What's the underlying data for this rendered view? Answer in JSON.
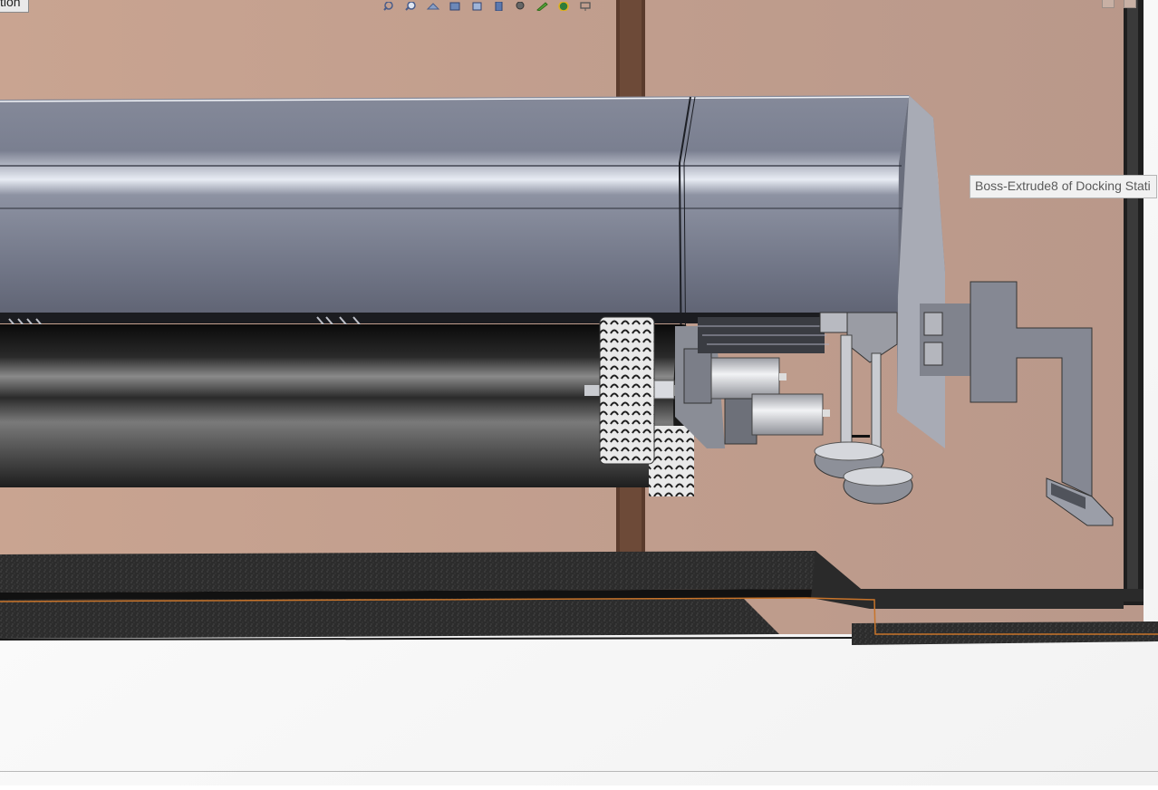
{
  "viewport": {
    "tab_label": "tion",
    "tooltip": "Boss-Extrude8 of Docking Stati",
    "background_color": "#c8a38f",
    "floor_color": "#ffffff",
    "accent_edge_color": "#c8742a"
  },
  "heads_up_toolbar": {
    "buttons": [
      "zoom-to-fit-icon",
      "zoom-to-area-icon",
      "previous-view-icon",
      "section-view-icon",
      "view-orientation-icon",
      "display-style-icon",
      "hide-show-items-icon",
      "edit-appearance-icon",
      "apply-scene-icon",
      "view-settings-icon"
    ]
  },
  "model": {
    "parts": [
      "docking-station-housing",
      "robot-body-shell",
      "drive-roller",
      "drive-wheel",
      "drive-motor",
      "caster-wheel",
      "charging-bracket",
      "base-plate"
    ]
  }
}
